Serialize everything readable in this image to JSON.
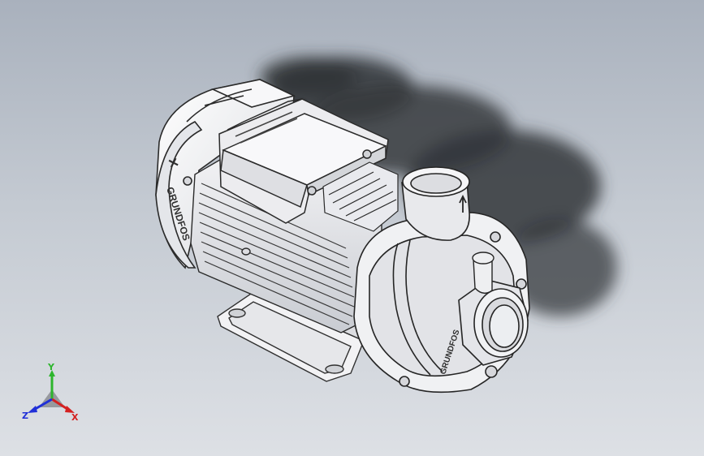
{
  "viewport": {
    "model": {
      "motor_brand_text": "GRUNDFOS",
      "pump_brand_text": "GRUNDFOS"
    },
    "triad": {
      "x_label": "X",
      "y_label": "Y",
      "z_label": "Z",
      "x_color": "#d42020",
      "y_color": "#2db52d",
      "z_color": "#2030d8"
    },
    "background": {
      "top_color": "#a9b1bd",
      "bottom_color": "#dde0e5"
    }
  }
}
